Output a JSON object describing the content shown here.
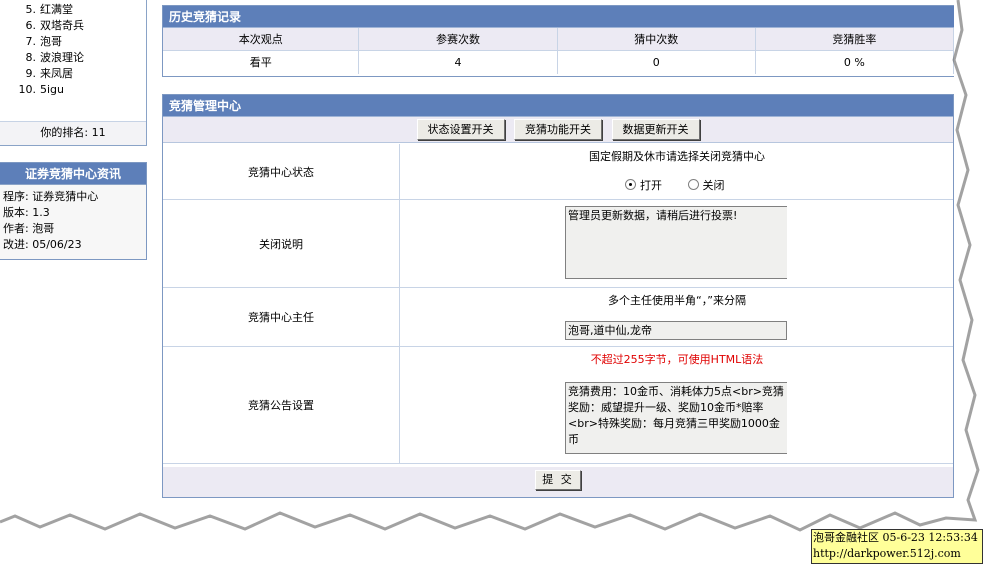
{
  "ranking": {
    "items": [
      {
        "num": "5.",
        "name": "红满堂"
      },
      {
        "num": "6.",
        "name": "双塔奇兵"
      },
      {
        "num": "7.",
        "name": "泡哥"
      },
      {
        "num": "8.",
        "name": "波浪理论"
      },
      {
        "num": "9.",
        "name": "来凤居"
      },
      {
        "num": "10.",
        "name": "5igu"
      }
    ],
    "my_rank_label": "你的排名: 11"
  },
  "info": {
    "title": "证券竞猜中心资讯",
    "lines": [
      "程序: 证券竞猜中心",
      "版本: 1.3",
      "作者: 泡哥",
      "改进: 05/06/23"
    ]
  },
  "history": {
    "title": "历史竞猜记录",
    "columns": [
      "本次观点",
      "参赛次数",
      "猜中次数",
      "竞猜胜率"
    ],
    "row": [
      "看平",
      "4",
      "0",
      "0 %"
    ]
  },
  "manager": {
    "title": "竞猜管理中心",
    "tabs": [
      "状态设置开关",
      "竞猜功能开关",
      "数据更新开关"
    ],
    "status": {
      "label": "竞猜中心状态",
      "hint": "国定假期及休市请选择关闭竞猜中心",
      "open_label": "打开",
      "close_label": "关闭",
      "selected": "打开"
    },
    "close_note": {
      "label": "关闭说明",
      "value": "管理员更新数据，请稍后进行投票!"
    },
    "directors": {
      "label": "竞猜中心主任",
      "hint": "多个主任使用半角“，”来分隔",
      "value": "泡哥,道中仙,龙帝"
    },
    "notice": {
      "label": "竞猜公告设置",
      "hint": "不超过255字节，可使用HTML语法",
      "value": "竞猜费用：10金币、消耗体力5点<br>竞猜奖励：威望提升一级、奖励10金币*赔率<br>特殊奖励：每月竞猜三甲奖励1000金币"
    },
    "submit_label": "提 交"
  },
  "watermark": {
    "line1": "泡哥金融社区  05-6-23 12:53:34",
    "line2": "http://darkpower.512j.com"
  }
}
